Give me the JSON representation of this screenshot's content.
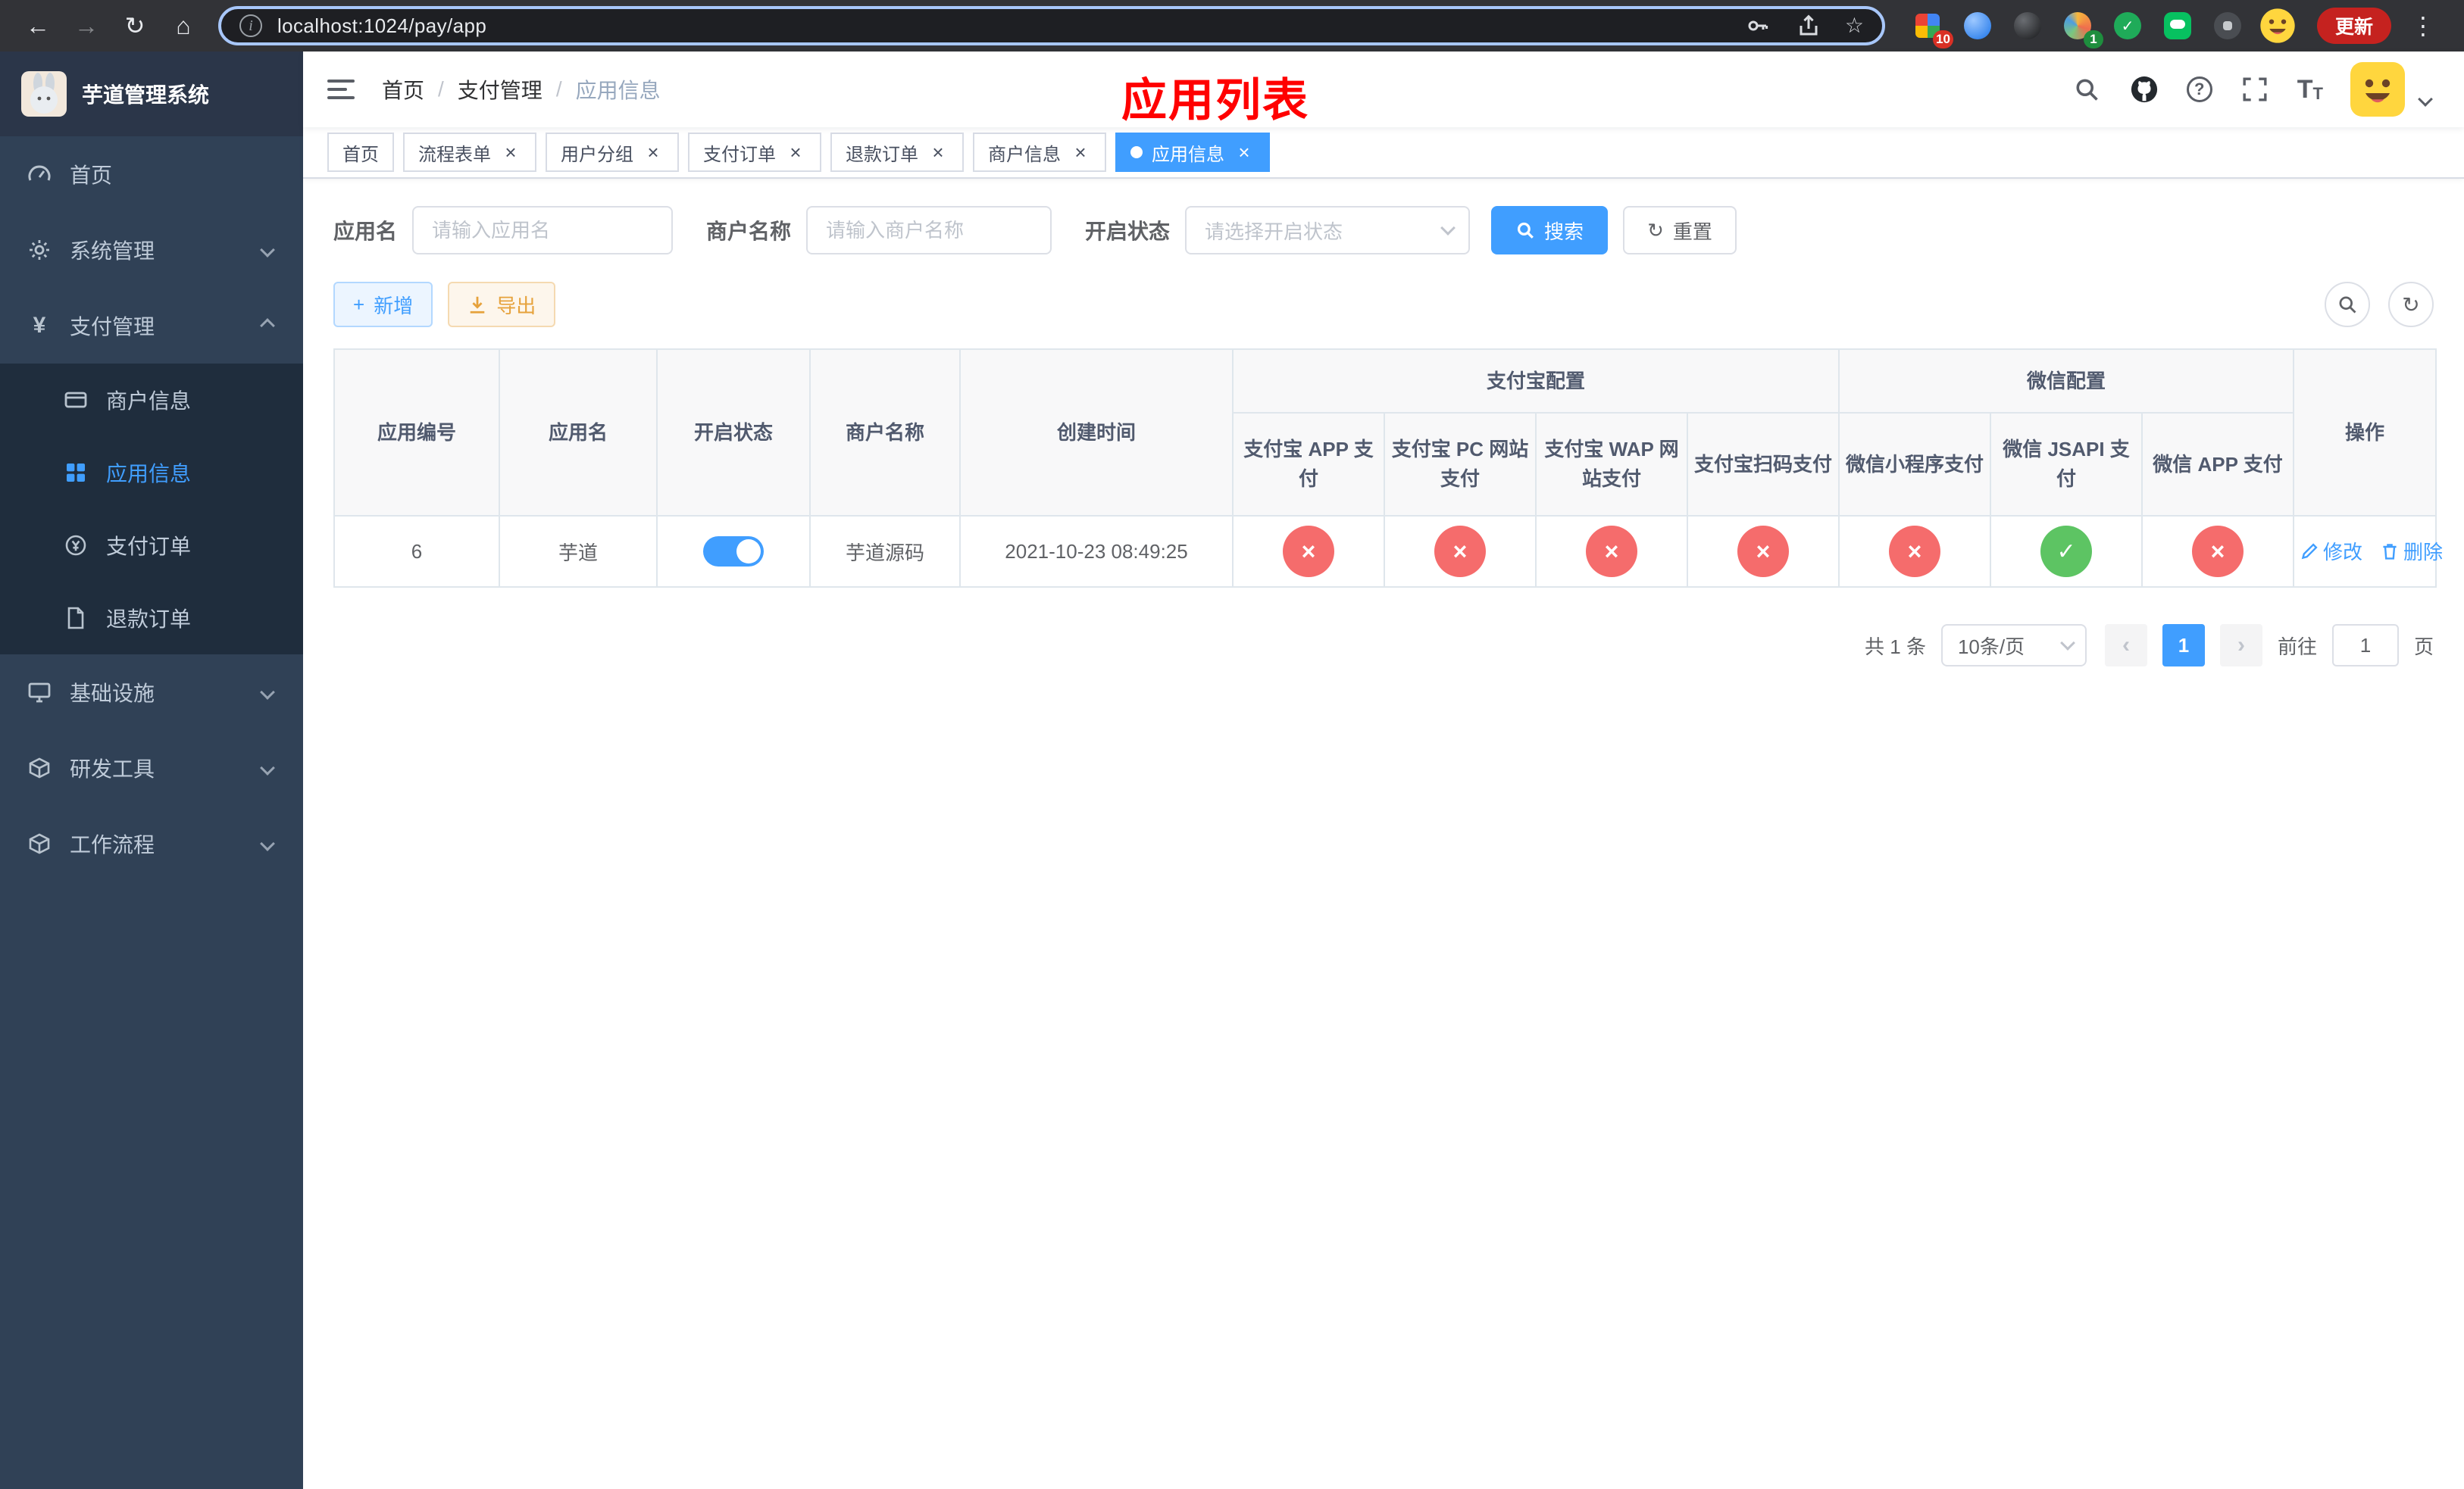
{
  "browser": {
    "url": "localhost:1024/pay/app",
    "update_label": "更新",
    "extension_badge_count": "10",
    "profile_badge_count": "1"
  },
  "icons": {
    "back": "←",
    "forward": "→",
    "reload": "↻",
    "home": "⌂",
    "info": "i",
    "star": "☆",
    "kebab": "⋮",
    "question": "?",
    "font_large": "T",
    "font_small": "T",
    "yen": "¥",
    "plus": "+",
    "refresh": "↻",
    "close": "×",
    "prev": "‹",
    "next": "›"
  },
  "sidebar": {
    "app_title": "芋道管理系统",
    "menu": [
      {
        "label": "首页"
      },
      {
        "label": "系统管理"
      },
      {
        "label": "支付管理"
      },
      {
        "label": "商户信息"
      },
      {
        "label": "应用信息"
      },
      {
        "label": "支付订单"
      },
      {
        "label": "退款订单"
      },
      {
        "label": "基础设施"
      },
      {
        "label": "研发工具"
      },
      {
        "label": "工作流程"
      }
    ]
  },
  "header": {
    "breadcrumb": [
      {
        "label": "首页"
      },
      {
        "label": "支付管理"
      },
      {
        "label": "应用信息"
      }
    ],
    "breadcrumb_separator": "/",
    "page_overlay_title": "应用列表"
  },
  "tabs": [
    {
      "label": "首页"
    },
    {
      "label": "流程表单"
    },
    {
      "label": "用户分组"
    },
    {
      "label": "支付订单"
    },
    {
      "label": "退款订单"
    },
    {
      "label": "商户信息"
    },
    {
      "label": "应用信息"
    }
  ],
  "filters": {
    "app_name_label": "应用名",
    "app_name_placeholder": "请输入应用名",
    "merchant_label": "商户名称",
    "merchant_placeholder": "请输入商户名称",
    "status_label": "开启状态",
    "status_placeholder": "请选择开启状态",
    "search_label": "搜索",
    "reset_label": "重置"
  },
  "toolbar": {
    "add_label": "新增",
    "export_label": "导出"
  },
  "table": {
    "headers": {
      "app_id": "应用编号",
      "app_name": "应用名",
      "status": "开启状态",
      "merchant_name": "商户名称",
      "create_time": "创建时间",
      "alipay_group": "支付宝配置",
      "wechat_group": "微信配置",
      "actions": "操作",
      "alipay_app": "支付宝 APP 支付",
      "alipay_pc": "支付宝 PC 网站支付",
      "alipay_wap": "支付宝 WAP 网站支付",
      "alipay_qr": "支付宝扫码支付",
      "wechat_mini": "微信小程序支付",
      "wechat_jsapi": "微信 JSAPI 支付",
      "wechat_app": "微信 APP 支付"
    },
    "row": {
      "app_id": "6",
      "app_name": "芋道",
      "status_on": true,
      "merchant_name": "芋道源码",
      "create_time": "2021-10-23 08:49:25",
      "flags": {
        "alipay_app": false,
        "alipay_pc": false,
        "alipay_wap": false,
        "alipay_qr": false,
        "wechat_mini": false,
        "wechat_jsapi": true,
        "wechat_app": false
      },
      "edit_label": "修改",
      "delete_label": "删除"
    }
  },
  "pagination": {
    "total_text": "共 1 条",
    "page_size_text": "10条/页",
    "current_page": "1",
    "goto_prefix": "前往",
    "goto_value": "1",
    "goto_suffix": "页"
  }
}
